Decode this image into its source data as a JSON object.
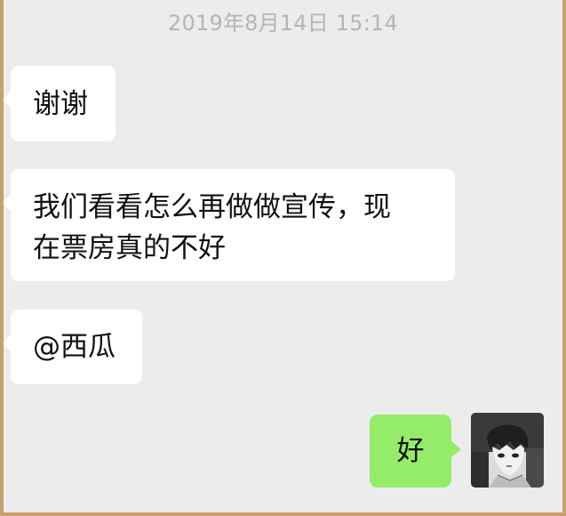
{
  "chat": {
    "timestamp": "2019年8月14日 15:14",
    "messages": [
      {
        "sender": "other",
        "text": "谢谢"
      },
      {
        "sender": "other",
        "text": "我们看看怎么再做做宣传，现\n在票房真的不好"
      },
      {
        "sender": "other",
        "text": "@西瓜"
      },
      {
        "sender": "self",
        "text": "好"
      }
    ]
  },
  "icons": {
    "avatar": "user-avatar-anime-character"
  },
  "colors": {
    "page_border": "#c89f72",
    "chat_background": "#ececec",
    "incoming_bubble": "#ffffff",
    "outgoing_bubble": "#95ec69",
    "timestamp_text": "#b5b5b5"
  }
}
